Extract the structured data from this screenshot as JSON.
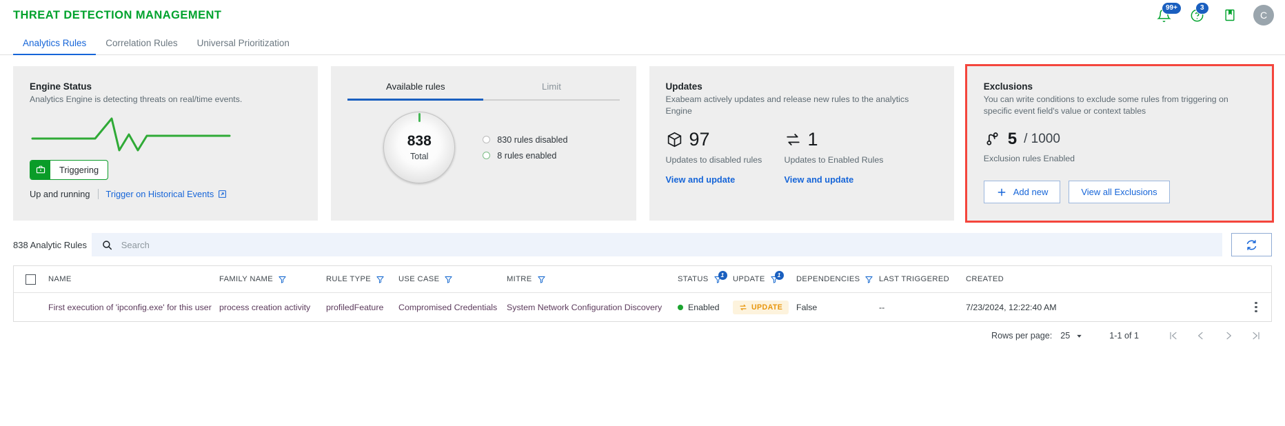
{
  "header": {
    "title": "THREAT DETECTION MANAGEMENT",
    "accent_color": "#00a22d",
    "notifications_badge": "99+",
    "help_badge": "3",
    "avatar_initial": "C",
    "icons": [
      "bell-icon",
      "help-circle-icon",
      "book-icon",
      "avatar"
    ]
  },
  "tabs": [
    {
      "label": "Analytics Rules",
      "active": true
    },
    {
      "label": "Correlation Rules",
      "active": false
    },
    {
      "label": "Universal Prioritization",
      "active": false
    }
  ],
  "cards": {
    "engine_status": {
      "title": "Engine Status",
      "subtitle": "Analytics Engine is detecting threats on real/time events.",
      "sparkline_color": "#2faa36",
      "badge_label": "Triggering",
      "badge_icon": "briefcase-icon",
      "badge_color": "#0a9c28",
      "status_text": "Up and running",
      "link_label": "Trigger on Historical Events",
      "link_icon": "external-link-icon"
    },
    "available_rules": {
      "tabs": [
        {
          "label": "Available rules",
          "active": true
        },
        {
          "label": "Limit",
          "active": false
        }
      ],
      "total_value": "838",
      "total_label": "Total",
      "legend": [
        {
          "label": "830 rules disabled",
          "color": "#bcbcbc"
        },
        {
          "label": "8 rules enabled",
          "color": "#7dbd86"
        }
      ]
    },
    "updates": {
      "title": "Updates",
      "subtitle": "Exabeam actively updates and release new rules to the analytics Engine",
      "metrics": [
        {
          "icon": "cube-icon",
          "value": "97",
          "label": "Updates to disabled rules",
          "link": "View and update"
        },
        {
          "icon": "swap-icon",
          "value": "1",
          "label": "Updates to Enabled Rules",
          "link": "View and update"
        }
      ]
    },
    "exclusions": {
      "title": "Exclusions",
      "subtitle": "You can write conditions to exclude some rules from triggering on specific event field's value or context tables",
      "icon": "branch-icon",
      "value": "5",
      "denominator": "/ 1000",
      "label": "Exclusion rules Enabled",
      "add_button": "Add new",
      "view_button": "View all Exclusions",
      "highlight_color": "#f4453c"
    }
  },
  "toolbar": {
    "rules_count": "838 Analytic Rules",
    "search_value": "",
    "search_placeholder": "Search",
    "search_icon": "search-icon",
    "refresh_icon": "refresh-icon"
  },
  "table": {
    "columns": [
      {
        "key": "checkbox",
        "label": "",
        "filter": false
      },
      {
        "key": "name",
        "label": "NAME",
        "filter": false
      },
      {
        "key": "family",
        "label": "FAMILY NAME",
        "filter": true
      },
      {
        "key": "ruletype",
        "label": "RULE TYPE",
        "filter": true
      },
      {
        "key": "usecase",
        "label": "USE CASE",
        "filter": true
      },
      {
        "key": "mitre",
        "label": "MITRE",
        "filter": true
      },
      {
        "key": "status",
        "label": "STATUS",
        "filter": true,
        "filter_badge": "1"
      },
      {
        "key": "update",
        "label": "UPDATE",
        "filter": true,
        "filter_badge": "1"
      },
      {
        "key": "deps",
        "label": "DEPENDENCIES",
        "filter": true
      },
      {
        "key": "last",
        "label": "LAST TRIGGERED",
        "filter": false
      },
      {
        "key": "created",
        "label": "CREATED",
        "filter": false
      }
    ],
    "rows": [
      {
        "name": "First execution of 'ipconfig.exe' for this user",
        "family": "process creation activity",
        "ruletype": "profiledFeature",
        "usecase": "Compromised Credentials",
        "mitre": "System Network Configuration Discovery",
        "status": "Enabled",
        "status_color": "#1ba42f",
        "update": "UPDATE",
        "deps": "False",
        "last": "--",
        "created": "7/23/2024, 12:22:40 AM"
      }
    ]
  },
  "pagination": {
    "rows_per_page_label": "Rows per page:",
    "rows_per_page_value": "25",
    "range": "1-1 of 1",
    "buttons": [
      "first-page",
      "prev-page",
      "next-page",
      "last-page"
    ]
  }
}
